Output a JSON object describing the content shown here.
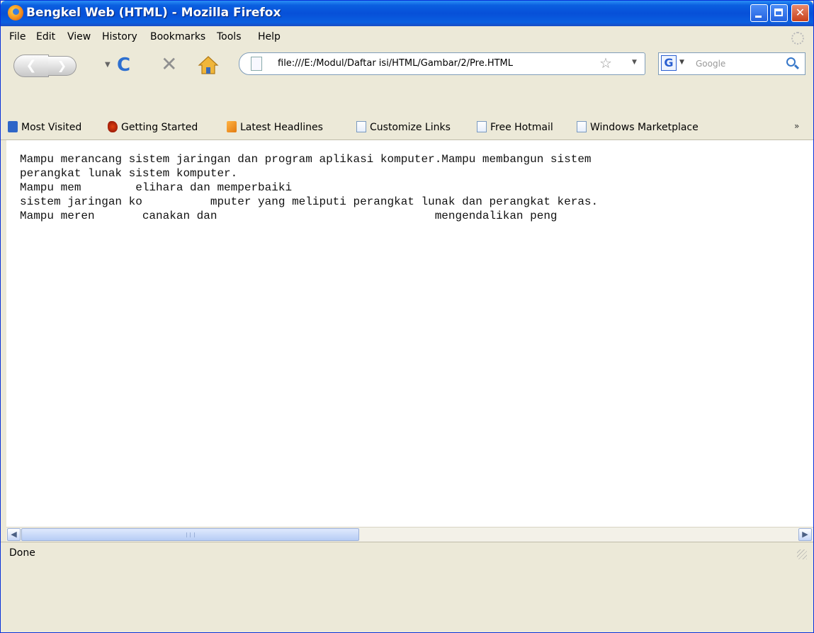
{
  "window": {
    "title": "Bengkel Web (HTML) - Mozilla Firefox"
  },
  "menubar": {
    "items": [
      "File",
      "Edit",
      "View",
      "History",
      "Bookmarks",
      "Tools",
      "Help"
    ]
  },
  "navigation": {
    "url": "file:///E:/Modul/Daftar isi/HTML/Gambar/2/Pre.HTML",
    "search_engine_glyph": "G",
    "search_placeholder": "Google"
  },
  "bookmarks": {
    "items": [
      {
        "label": "Most Visited",
        "icon": "most-visited-icon"
      },
      {
        "label": "Getting Started",
        "icon": "firefox-icon"
      },
      {
        "label": "Latest Headlines",
        "icon": "rss-icon"
      },
      {
        "label": "Customize Links",
        "icon": "page-icon"
      },
      {
        "label": "Free Hotmail",
        "icon": "page-icon"
      },
      {
        "label": "Windows Marketplace",
        "icon": "page-icon"
      }
    ],
    "overflow": "»"
  },
  "content": {
    "pre_text": "Mampu merancang sistem jaringan dan program aplikasi komputer.Mampu membangun sistem\nperangkat lunak sistem komputer.\nMampu mem        elihara dan memperbaiki\nsistem jaringan ko          mputer yang meliputi perangkat lunak dan perangkat keras.\nMampu meren       canakan dan                                mengendalikan peng"
  },
  "status": {
    "text": "Done"
  },
  "colors": {
    "titlebar": "#0750d8",
    "chrome": "#ece9d8"
  }
}
